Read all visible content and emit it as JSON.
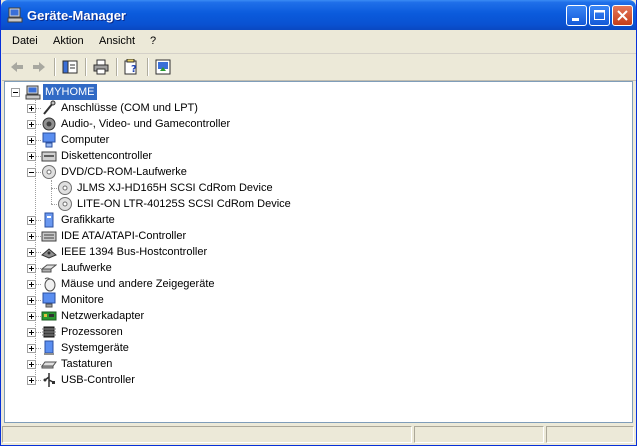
{
  "window": {
    "title": "Geräte-Manager",
    "title_icon": "computer-manager-icon"
  },
  "menu": [
    "Datei",
    "Aktion",
    "Ansicht",
    "?"
  ],
  "toolbar": {
    "buttons": [
      "back-arrow-icon",
      "forward-arrow-icon",
      "show-hide-tree-icon",
      "print-icon",
      "properties-help-icon",
      "update-driver-icon"
    ]
  },
  "tree": {
    "root": "MYHOME",
    "items": [
      {
        "label": "Anschlüsse (COM und LPT)",
        "icon": "port-icon"
      },
      {
        "label": "Audio-, Video- und Gamecontroller",
        "icon": "audio-icon"
      },
      {
        "label": "Computer",
        "icon": "computer-icon"
      },
      {
        "label": "Diskettencontroller",
        "icon": "floppy-controller-icon"
      },
      {
        "label": "DVD/CD-ROM-Laufwerke",
        "icon": "cdrom-icon",
        "expanded": true,
        "children": [
          {
            "label": "JLMS XJ-HD165H SCSI CdRom Device",
            "icon": "cdrom-icon"
          },
          {
            "label": "LITE-ON LTR-40125S SCSI CdRom Device",
            "icon": "cdrom-icon"
          }
        ]
      },
      {
        "label": "Grafikkarte",
        "icon": "display-adapter-icon"
      },
      {
        "label": "IDE ATA/ATAPI-Controller",
        "icon": "ide-controller-icon"
      },
      {
        "label": "IEEE 1394 Bus-Hostcontroller",
        "icon": "firewire-icon"
      },
      {
        "label": "Laufwerke",
        "icon": "disk-drive-icon"
      },
      {
        "label": "Mäuse und andere Zeigegeräte",
        "icon": "mouse-icon"
      },
      {
        "label": "Monitore",
        "icon": "monitor-icon"
      },
      {
        "label": "Netzwerkadapter",
        "icon": "network-adapter-icon"
      },
      {
        "label": "Prozessoren",
        "icon": "processor-icon"
      },
      {
        "label": "Systemgeräte",
        "icon": "system-device-icon"
      },
      {
        "label": "Tastaturen",
        "icon": "keyboard-icon"
      },
      {
        "label": "USB-Controller",
        "icon": "usb-icon"
      }
    ]
  }
}
